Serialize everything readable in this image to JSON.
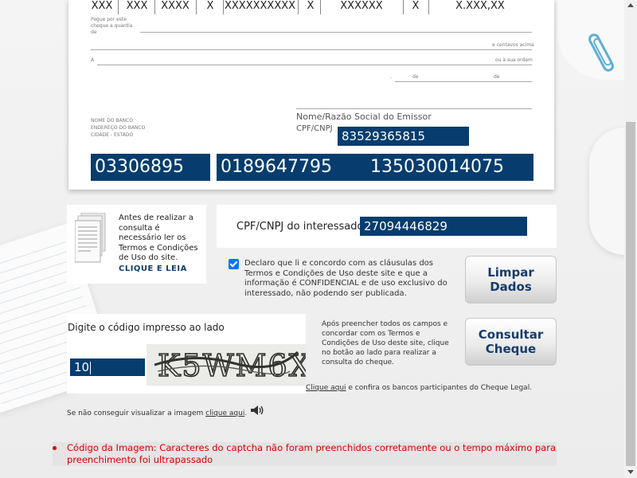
{
  "cheque": {
    "top_fields": [
      "XXX",
      "XXX",
      "XXXX",
      "X",
      "XXXXXXXXXX",
      "X",
      "XXXXXX",
      "X",
      "X.XXX,XX"
    ],
    "pay_label": "Pague por este cheque a quantia de",
    "centavos_label": "e centavos acima",
    "ordem_label": "ou à sua ordem",
    "a_label": "A",
    "de1": ",",
    "de2": "de",
    "de3": "de",
    "bank_info_1": "NOME DO BANCO",
    "bank_info_2": "ENDEREÇO DO BANCO",
    "bank_info_3": "CIDADE - ESTADO",
    "issuer_label": "Nome/Razão Social do Emissor",
    "cpf_label": "CPF/CNPJ",
    "cpf_value": "83529365815",
    "field1": "03306895",
    "field2": "0189647795",
    "field3": "135030014075"
  },
  "terms": {
    "text": "Antes de realizar a consulta é necessário ler os Termos e Condições de Uso do site.",
    "link": "CLIQUE E LEIA"
  },
  "interessado": {
    "label": "CPF/CNPJ do interessado",
    "value": "27094446829"
  },
  "agree": {
    "checked": true,
    "text": "Declaro que li e concordo com as cláusulas dos Termos e Condições de Uso deste site e que a informação é CONFIDENCIAL e de uso exclusivo do interessado, não podendo ser publicada."
  },
  "buttons": {
    "clear": "Limpar Dados",
    "consult": "Consultar Cheque"
  },
  "captcha": {
    "label": "Digite o código impresso ao lado",
    "value": "10",
    "image_text": "K5WM6X"
  },
  "help": {
    "text": "Após preencher todos os campos e concordar com os Termos e Condições de Uso deste site, clique no botão ao lado para realizar a consulta do cheque.",
    "banks_link": "Clique aqui",
    "banks_rest": " e confira os bancos participantes do Cheque Legal.",
    "noview_text": "Se não conseguir visualizar a imagem ",
    "noview_link": "clique aqui",
    "noview_end": "."
  },
  "error": {
    "text": "Código da Imagem: Caracteres do captcha não foram preenchidos corretamente ou o tempo máximo para preenchimento foi ultrapassado"
  },
  "colors": {
    "field_blue": "#063d6e",
    "button_text": "#173c6b",
    "error_red": "#d40000",
    "checkbox": "#0075ff"
  },
  "icons": [
    "document-icon",
    "speaker-icon",
    "paperclip-icon"
  ]
}
